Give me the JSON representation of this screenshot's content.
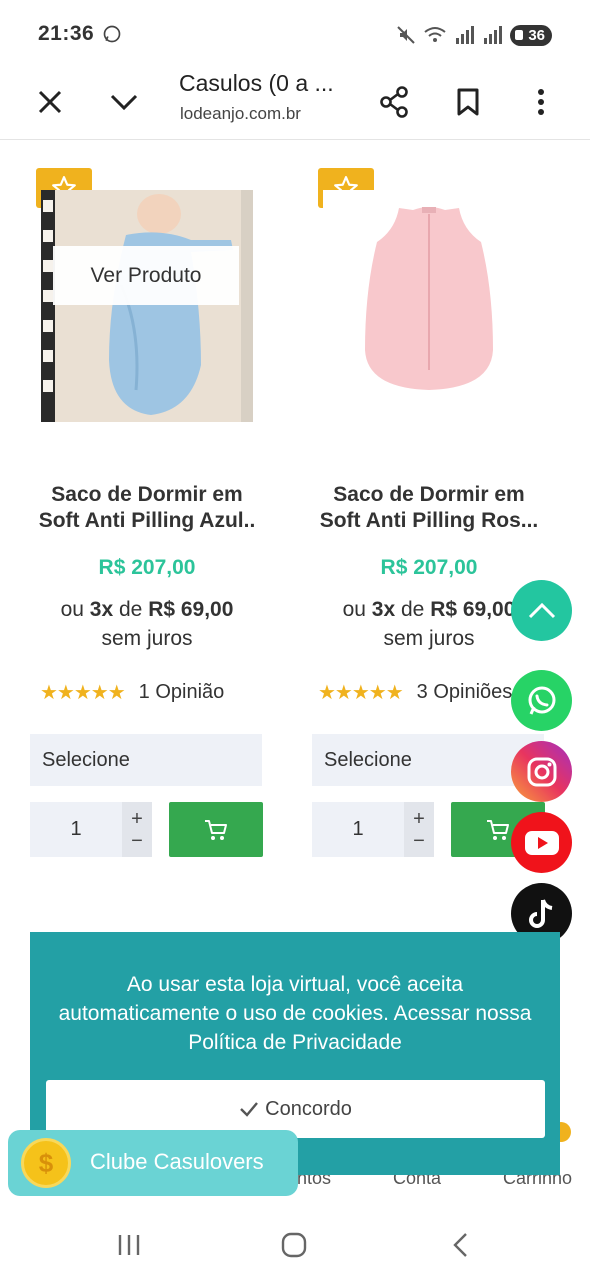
{
  "status_bar": {
    "time": "21:36",
    "battery": "36"
  },
  "browser": {
    "title": "Casulos (0 a ...",
    "url": "lodeanjo.com.br"
  },
  "products": [
    {
      "view_label": "Ver Produto",
      "name_line1": "Saco de Dormir em",
      "name_line2": "Soft Anti Pilling Azul..",
      "price": "R$ 207,00",
      "installment_prefix": "ou",
      "installment_count": "3x",
      "installment_mid": "de",
      "installment_value": "R$ 69,00",
      "installment_suffix": "sem juros",
      "stars": "★★★★★",
      "reviews": "1 Opinião",
      "select_label": "Selecione",
      "quantity": "1",
      "qty_plus": "+",
      "qty_minus": "−"
    },
    {
      "name_line1": "Saco de Dormir em",
      "name_line2": "Soft Anti Pilling Ros...",
      "price": "R$ 207,00",
      "installment_prefix": "ou",
      "installment_count": "3x",
      "installment_mid": "de",
      "installment_value": "R$ 69,00",
      "installment_suffix": "sem juros",
      "stars": "★★★★★",
      "reviews": "3 Opiniões",
      "select_label": "Selecione",
      "quantity": "1",
      "qty_plus": "+",
      "qty_minus": "−"
    }
  ],
  "bottom_nav": {
    "item2": "ntos",
    "item3": "Conta",
    "item4": "Carrinho"
  },
  "cookie": {
    "message": "Ao usar esta loja virtual, você aceita automaticamente o uso de cookies. Acessar nossa Política de Privacidade",
    "accept_label": "Concordo"
  },
  "club": {
    "label": "Clube Casulovers",
    "coin_symbol": "$"
  },
  "colors": {
    "accent_green": "#2cc49a",
    "teal": "#23a0a5",
    "star": "#f0b21e",
    "cart": "#35a84f"
  }
}
